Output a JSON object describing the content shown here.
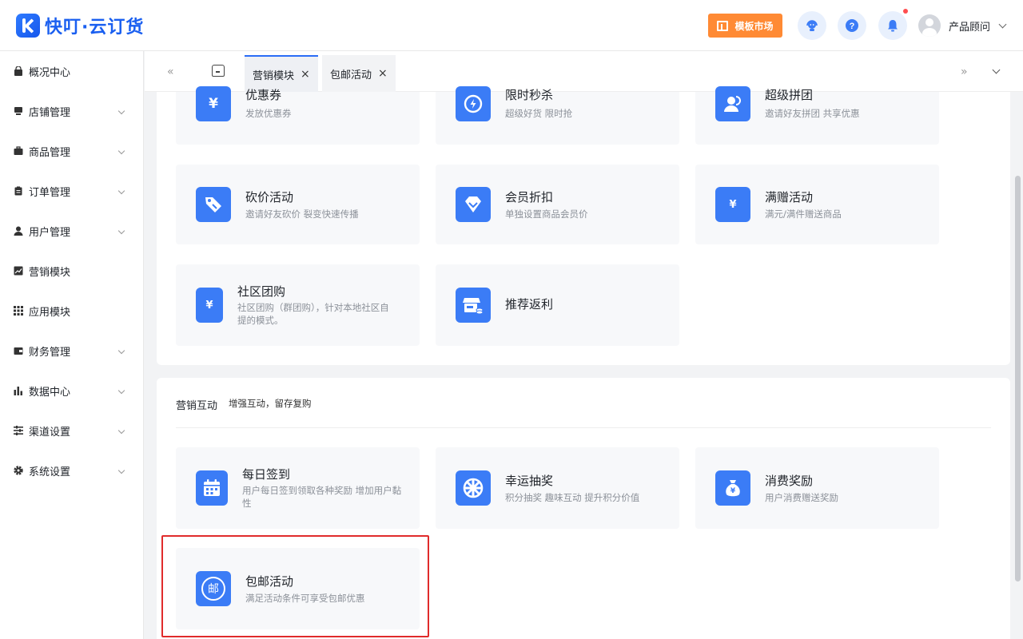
{
  "header": {
    "logo_text": "快叮·云订货",
    "template_market": "模板市场",
    "user_name": "产品顾问"
  },
  "sidebar": {
    "items": [
      {
        "label": "概况中心",
        "icon": "shop-bag-icon",
        "has_chevron": false
      },
      {
        "label": "店铺管理",
        "icon": "store-icon",
        "has_chevron": true
      },
      {
        "label": "商品管理",
        "icon": "briefcase-icon",
        "has_chevron": true
      },
      {
        "label": "订单管理",
        "icon": "clipboard-icon",
        "has_chevron": true
      },
      {
        "label": "用户管理",
        "icon": "user-icon",
        "has_chevron": true
      },
      {
        "label": "营销模块",
        "icon": "trend-chart-icon",
        "has_chevron": false
      },
      {
        "label": "应用模块",
        "icon": "grid-icon",
        "has_chevron": false
      },
      {
        "label": "财务管理",
        "icon": "wallet-icon",
        "has_chevron": true
      },
      {
        "label": "数据中心",
        "icon": "bar-chart-icon",
        "has_chevron": true
      },
      {
        "label": "渠道设置",
        "icon": "list-settings-icon",
        "has_chevron": true
      },
      {
        "label": "系统设置",
        "icon": "gear-icon",
        "has_chevron": true
      }
    ]
  },
  "tabs": {
    "prev": "«",
    "next": "»",
    "items": [
      {
        "label": "营销模块",
        "close": "×"
      },
      {
        "label": "包邮活动",
        "close": "×"
      }
    ]
  },
  "top_cards": [
    {
      "title": "优惠券",
      "desc": "发放优惠券",
      "icon": "coupon-icon",
      "glyph": "¥"
    },
    {
      "title": "限时秒杀",
      "desc": "超级好货 限时抢",
      "icon": "flash-clock-icon",
      "glyph": "⚡"
    },
    {
      "title": "超级拼团",
      "desc": "邀请好友拼团 共享优惠",
      "icon": "group-icon",
      "glyph": ""
    },
    {
      "title": "砍价活动",
      "desc": "邀请好友砍价 裂变快速传播",
      "icon": "price-tag-icon",
      "glyph": ""
    },
    {
      "title": "会员折扣",
      "desc": "单独设置商品会员价",
      "icon": "diamond-icon",
      "glyph": ""
    },
    {
      "title": "满赠活动",
      "desc": "满元/满件赠送商品",
      "icon": "gift-ticket-icon",
      "glyph": "¥"
    },
    {
      "title": "社区团购",
      "desc": "社区团购（群团购），针对本地社区自提的模式。",
      "icon": "community-ticket-icon",
      "glyph": "¥"
    },
    {
      "title": "推荐返利",
      "desc": "",
      "icon": "shop-rebate-icon",
      "glyph": ""
    }
  ],
  "interaction_section": {
    "title": "营销互动",
    "subtitle": "增强互动，留存复购",
    "cards": [
      {
        "title": "每日签到",
        "desc": "用户每日签到领取各种奖励 增加用户黏性",
        "icon": "calendar-icon",
        "glyph": ""
      },
      {
        "title": "幸运抽奖",
        "desc": "积分抽奖 趣味互动 提升积分价值",
        "icon": "wheel-icon",
        "glyph": ""
      },
      {
        "title": "消费奖励",
        "desc": "用户消费赠送奖励",
        "icon": "money-bag-icon",
        "glyph": "¥"
      },
      {
        "title": "包邮活动",
        "desc": "满足活动条件可享受包邮优惠",
        "icon": "mail-icon",
        "glyph": "邮"
      }
    ]
  },
  "colors": {
    "accent": "#3b7cf6",
    "template_button": "#ff8a34",
    "highlight_border": "#e02b2b"
  }
}
